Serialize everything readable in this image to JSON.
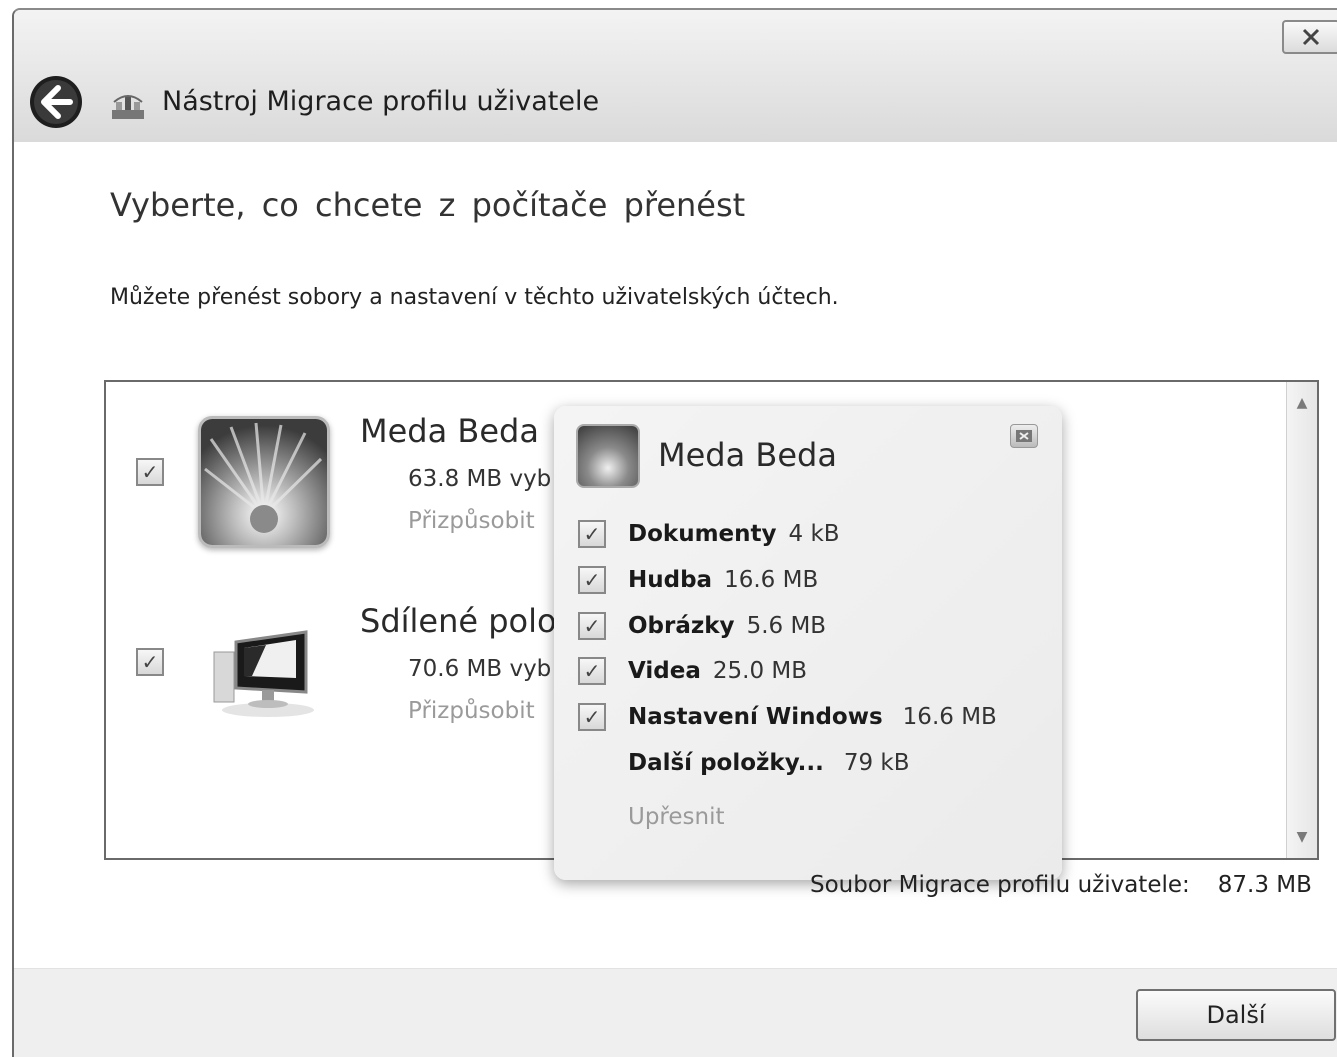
{
  "window": {
    "title": "Nástroj Migrace profilu uživatele",
    "close_icon": "close-icon",
    "back_icon": "back-arrow-icon"
  },
  "page": {
    "heading": "Vyberte, co chcete z počítače přenést",
    "subtext": "Můžete přenést sobory a nastavení v těchto uživatelských účtech."
  },
  "accounts": [
    {
      "name": "Meda Beda",
      "size": "63.8 MB vyb",
      "link": "Přizpůsobit",
      "checked": true,
      "icon": "user-avatar-flower-icon"
    },
    {
      "name": "Sdílené polož",
      "size": "70.6 MB vyb",
      "link": "Přizpůsobit",
      "checked": true,
      "icon": "computer-monitor-icon"
    }
  ],
  "flyout": {
    "name": "Meda Beda",
    "items": [
      {
        "label": "Dokumenty",
        "value": "4 kB",
        "checked": true
      },
      {
        "label": "Hudba",
        "value": "16.6 MB",
        "checked": true
      },
      {
        "label": "Obrázky",
        "value": "5.6 MB",
        "checked": true
      },
      {
        "label": "Videa",
        "value": "25.0 MB",
        "checked": true
      },
      {
        "label": "Nastavení Windows",
        "value": "16.6 MB",
        "checked": true
      }
    ],
    "other": {
      "label": "Další položky...",
      "value": "79 kB"
    },
    "advanced_link": "Upřesnit"
  },
  "footer": {
    "label": "Soubor Migrace profilu uživatele:",
    "value": "87.3 MB",
    "next_button": "Další"
  },
  "checkmark": "✓",
  "scroll_up": "▲",
  "scroll_down": "▼"
}
